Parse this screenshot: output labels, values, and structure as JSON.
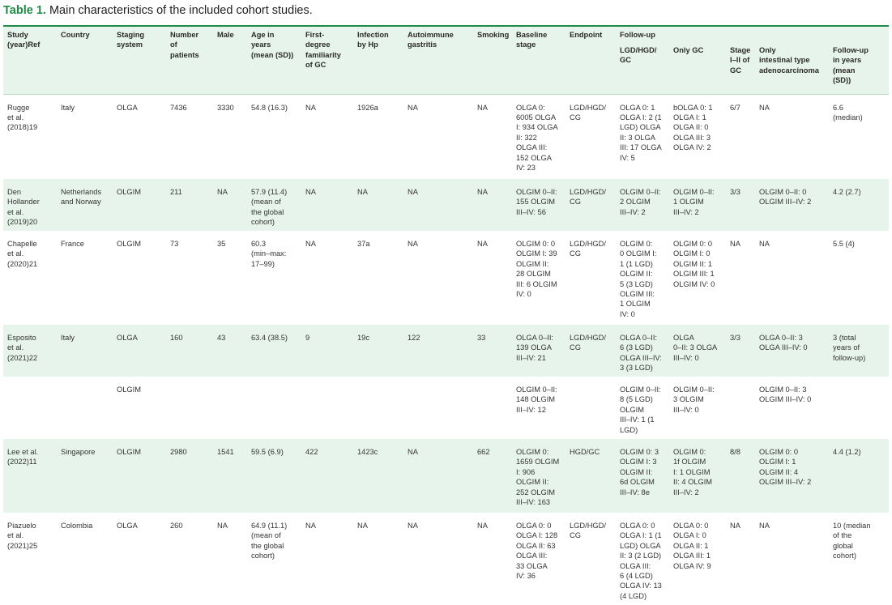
{
  "caption": {
    "label": "Table 1.",
    "text": "Main characteristics of the included cohort studies."
  },
  "headers": {
    "study": "Study\n(year)Ref",
    "country": "Country",
    "staging": "Staging\nsystem",
    "number": "Number\nof\npatients",
    "male": "Male",
    "age": "Age in\nyears\n(mean (SD))",
    "familiarity": "First-\ndegree\nfamiliarity\nof GC",
    "hp": "Infection\nby Hp",
    "autoimmune": "Autoimmune\ngastritis",
    "smoking": "Smoking",
    "baseline": "Baseline\nstage",
    "endpoint": "Endpoint",
    "followup": "Follow-up",
    "lgd": "LGD/HGD/\nGC",
    "only_gc": "Only GC",
    "stage_i_ii": "Stage\nI–II of\nGC",
    "only_intestinal": "Only\nintestinal type\nadenocarcinoma",
    "fu_years": "Follow-up\nin years\n(mean\n(SD))"
  },
  "rows": [
    [
      "Rugge\net al.\n(2018)19",
      "Italy",
      "OLGA",
      "7436",
      "3330",
      "54.8 (16.3)",
      "NA",
      "1926a",
      "NA",
      "NA",
      "OLGA 0:\n6005 OLGA\nI: 934 OLGA\nII: 322\nOLGA III:\n152 OLGA\nIV: 23",
      "LGD/HGD/\nCG",
      "OLGA 0: 1\nOLGA I: 2 (1\nLGD) OLGA\nII: 3 OLGA\nIII: 17 OLGA\nIV: 5",
      "bOLGA 0: 1\nOLGA I: 1\nOLGA II: 0\nOLGA III: 3\nOLGA IV: 2",
      "6/7",
      "NA",
      "6.6\n(median)"
    ],
    [
      "Den\nHollander\net al.\n(2019)20",
      "Netherlands\nand Norway",
      "OLGIM",
      "211",
      "NA",
      "57.9 (11.4)\n(mean of\nthe global\ncohort)",
      "NA",
      "NA",
      "NA",
      "NA",
      "OLGIM 0–II:\n155 OLGIM\nIII–IV: 56",
      "LGD/HGD/\nCG",
      "OLGIM 0–II:\n2 OLGIM\nIII–IV: 2",
      "OLGIM 0–II:\n1 OLGIM\nIII–IV: 2",
      "3/3",
      "OLGIM 0–II: 0\nOLGIM III–IV: 2",
      "4.2 (2.7)"
    ],
    [
      "Chapelle\net al.\n(2020)21",
      "France",
      "OLGIM",
      "73",
      "35",
      "60.3\n(min–max:\n17–99)",
      "NA",
      "37a",
      "NA",
      "NA",
      "OLGIM 0: 0\nOLGIM I: 39\nOLGIM II:\n28 OLGIM\nIII: 6 OLGIM\nIV: 0",
      "LGD/HGD/\nCG",
      "OLGIM 0:\n0 OLGIM I:\n1 (1 LGD)\nOLGIM II:\n5 (3 LGD)\nOLGIM III:\n1 OLGIM\nIV: 0",
      "OLGIM 0: 0\nOLGIM I: 0\nOLGIM II: 1\nOLGIM III: 1\nOLGIM IV: 0",
      "NA",
      "NA",
      "5.5 (4)"
    ],
    [
      "Esposito\net al.\n(2021)22",
      "Italy",
      "OLGA",
      "160",
      "43",
      "63.4 (38.5)",
      "9",
      "19c",
      "122",
      "33",
      "OLGA 0–II:\n139 OLGA\nIII–IV: 21",
      "LGD/HGD/\nCG",
      "OLGA 0–II:\n6 (3 LGD)\nOLGA III–IV:\n3 (3 LGD)",
      "OLGA\n0–II: 3 OLGA\nIII–IV: 0",
      "3/3",
      "OLGA 0–II: 3\nOLGA III–IV: 0",
      "3 (total\nyears of\nfollow-up)"
    ],
    [
      "",
      "",
      "OLGIM",
      "",
      "",
      "",
      "",
      "",
      "",
      "",
      "OLGIM 0–II:\n148 OLGIM\nIII–IV: 12",
      "",
      "OLGIM 0–II:\n8 (5 LGD)\nOLGIM\nIII–IV: 1 (1\nLGD)",
      "OLGIM 0–II:\n3 OLGIM\nIII–IV: 0",
      "",
      "OLGIM 0–II: 3\nOLGIM III–IV: 0",
      ""
    ],
    [
      "Lee et al.\n(2022)11",
      "Singapore",
      "OLGIM",
      "2980",
      "1541",
      "59.5 (6.9)",
      "422",
      "1423c",
      "NA",
      "662",
      "OLGIM 0:\n1659 OLGIM\nI: 906\nOLGIM II:\n252 OLGIM\nIII–IV: 163",
      "HGD/GC",
      "OLGIM 0: 3\nOLGIM I: 3\nOLGIM II:\n6d OLGIM\nIII–IV: 8e",
      "OLGIM 0:\n1f OLGIM\nI: 1 OLGIM\nII: 4 OLGIM\nIII–IV: 2",
      "8/8",
      "OLGIM 0: 0\nOLGIM I: 1\nOLGIM II: 4\nOLGIM III–IV: 2",
      "4.4 (1.2)"
    ],
    [
      "Piazuelo\net al.\n(2021)25",
      "Colombia",
      "OLGA",
      "260",
      "NA",
      "64.9 (11.1)\n(mean of\nthe global\ncohort)",
      "NA",
      "NA",
      "NA",
      "NA",
      "OLGA 0: 0\nOLGA I: 128\nOLGA II: 63\nOLGA III:\n33 OLGA\nIV: 36",
      "LGD/HGD/\nCG",
      "OLGA 0: 0\nOLGA I: 1 (1\nLGD) OLGA\nII: 3 (2 LGD)\nOLGA III:\n6 (4 LGD)\nOLGA IV: 13\n(4 LGD)",
      "OLGA 0: 0\nOLGA I: 0\nOLGA II: 1\nOLGA III: 1\nOLGA IV: 9",
      "NA",
      "NA",
      "10 (median\nof the\nglobal\ncohort)"
    ]
  ],
  "colors": {
    "accent": "#1f8a45",
    "band": "#e7f4eb"
  }
}
